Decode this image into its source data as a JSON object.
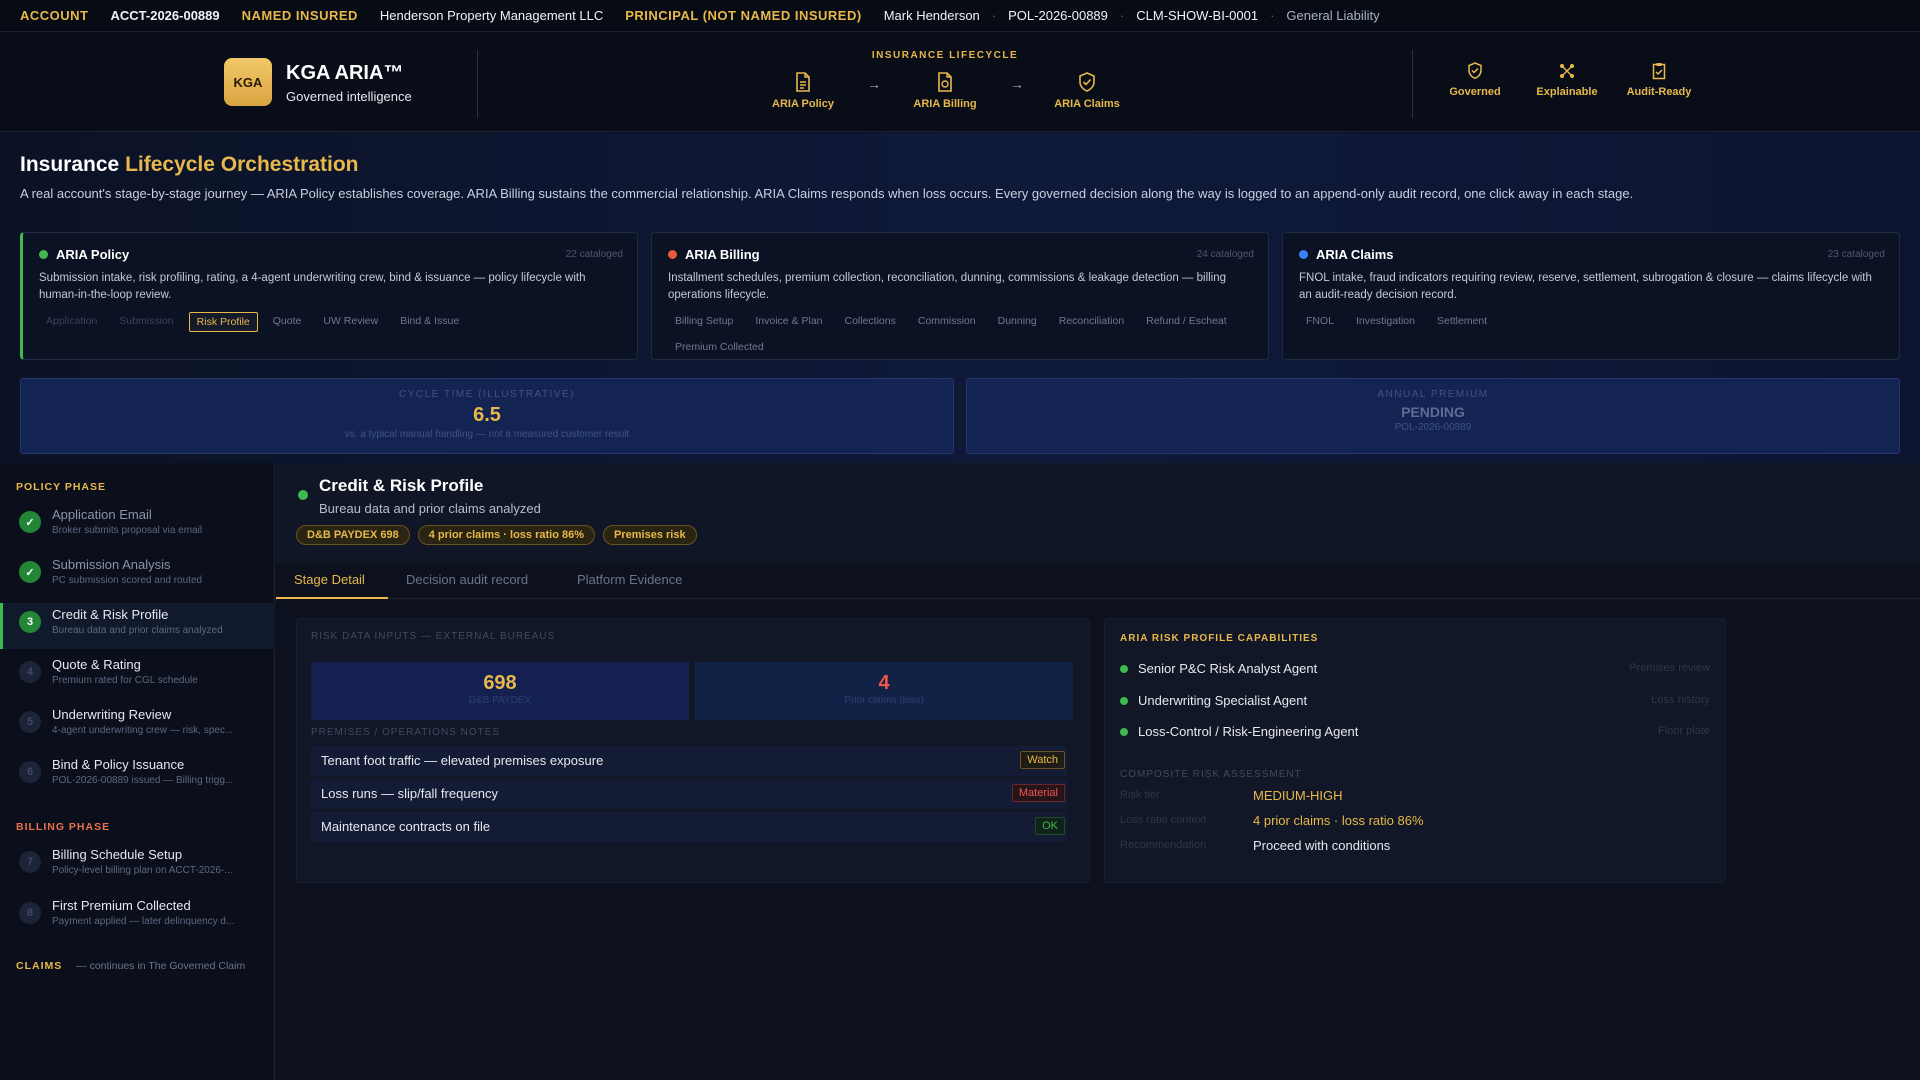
{
  "topbar": {
    "account_label": "ACCOUNT",
    "account_value": "ACCT-2026-00889",
    "named_insured_label": "NAMED INSURED",
    "named_insured_value": "Henderson Property Management LLC",
    "principal_label": "PRINCIPAL (NOT NAMED INSURED)",
    "principal_value": "Mark Henderson",
    "policy_id": "POL-2026-00889",
    "claim_id": "CLM-SHOW-BI-0001",
    "line_of_business": "General Liability",
    "separator": "·"
  },
  "header": {
    "logo_text": "KGA",
    "brand_name": "KGA ARIA™",
    "brand_tagline": "Governed intelligence",
    "lifecycle_title": "INSURANCE LIFECYCLE",
    "lifecycle_steps": [
      {
        "label": "ARIA Policy",
        "icon": "document-icon"
      },
      {
        "label": "ARIA Billing",
        "icon": "invoice-icon"
      },
      {
        "label": "ARIA Claims",
        "icon": "shield-check-icon"
      }
    ],
    "arrow": "→",
    "badges": [
      {
        "label": "Governed",
        "icon": "shield-icon"
      },
      {
        "label": "Explainable",
        "icon": "nodes-icon"
      },
      {
        "label": "Audit-Ready",
        "icon": "clipboard-check-icon"
      }
    ]
  },
  "hero": {
    "title_plain": "Insurance",
    "title_accent": "Lifecycle Orchestration",
    "description": "A real account's stage-by-stage journey — ARIA Policy establishes coverage. ARIA Billing sustains the commercial relationship. ARIA Claims responds when loss occurs. Every governed decision along the way is logged to an append-only audit record, one click away in each stage.",
    "products": [
      {
        "name": "ARIA Policy",
        "count": "22 cataloged",
        "dot_color": "#3fb950",
        "description": "Submission intake, risk profiling, rating, a 4-agent underwriting crew, bind & issuance — policy lifecycle with human-in-the-loop review.",
        "chips": [
          "Application",
          "Submission",
          "Risk Profile",
          "Quote",
          "UW Review",
          "Bind & Issue"
        ]
      },
      {
        "name": "ARIA Billing",
        "count": "24 cataloged",
        "dot_color": "#e8593a",
        "description": "Installment schedules, premium collection, reconciliation, dunning, commissions & leakage detection — billing operations lifecycle.",
        "chips": [
          "Billing Setup",
          "Invoice & Plan",
          "Collections",
          "Commission",
          "Dunning",
          "Reconciliation",
          "Refund / Escheat",
          "Premium Collected"
        ]
      },
      {
        "name": "ARIA Claims",
        "count": "23 cataloged",
        "dot_color": "#3b82f6",
        "description": "FNOL intake, fraud indicators requiring review, reserve, settlement, subrogation & closure — claims lifecycle with an audit-ready decision record.",
        "chips": [
          "FNOL",
          "Investigation",
          "Settlement"
        ]
      }
    ],
    "metrics": [
      {
        "label": "CYCLE TIME (ILLUSTRATIVE)",
        "value": "6.5",
        "sub": "vs. a typical manual handling — not a measured customer result"
      },
      {
        "label": "ANNUAL PREMIUM",
        "value": "PENDING",
        "sub": "POL-2026-00889"
      }
    ]
  },
  "sidebar": {
    "policy_phase": "POLICY PHASE",
    "billing_phase": "BILLING PHASE",
    "claims_phase": "CLAIMS",
    "claims_note": "— continues in The Governed Claim",
    "check": "✓",
    "policy_steps": [
      {
        "num": "1",
        "title": "Application Email",
        "sub": "Broker submits proposal via email"
      },
      {
        "num": "2",
        "title": "Submission Analysis",
        "sub": "PC submission scored and routed"
      },
      {
        "num": "3",
        "title": "Credit & Risk Profile",
        "sub": "Bureau data and prior claims analyzed"
      },
      {
        "num": "4",
        "title": "Quote & Rating",
        "sub": "Premium rated for CGL schedule"
      },
      {
        "num": "5",
        "title": "Underwriting Review",
        "sub": "4-agent underwriting crew — risk, spec..."
      },
      {
        "num": "6",
        "title": "Bind & Policy Issuance",
        "sub": "POL-2026-00889 issued — Billing trigg..."
      }
    ],
    "billing_steps": [
      {
        "num": "7",
        "title": "Billing Schedule Setup",
        "sub": "Policy-level billing plan on ACCT-2026-..."
      },
      {
        "num": "8",
        "title": "First Premium Collected",
        "sub": "Payment applied — later delinquency d..."
      }
    ]
  },
  "stage": {
    "title": "Credit & Risk Profile",
    "subtitle": "Bureau data and prior claims analyzed",
    "tags": [
      "D&B PAYDEX 698",
      "4 prior claims · loss ratio 86%",
      "Premises risk"
    ],
    "tabs": [
      "Stage Detail",
      "Decision audit record",
      "Platform Evidence"
    ]
  },
  "risk_inputs": {
    "label": "RISK DATA INPUTS — EXTERNAL BUREAUS",
    "scores": [
      {
        "value": "698",
        "label": "D&B PAYDEX",
        "color": "#e8b84a"
      },
      {
        "value": "4",
        "label": "Prior claims (loss)",
        "color": "#f0564c"
      }
    ],
    "notes_label": "PREMISES / OPERATIONS NOTES",
    "notes": [
      {
        "text": "Tenant foot traffic — elevated premises exposure",
        "badge": "Watch",
        "kind": "watch"
      },
      {
        "text": "Loss runs — slip/fall frequency",
        "badge": "Material",
        "kind": "material"
      },
      {
        "text": "Maintenance contracts on file",
        "badge": "OK",
        "kind": "ok"
      }
    ]
  },
  "capabilities": {
    "label": "ARIA RISK PROFILE CAPABILITIES",
    "agents": [
      {
        "name": "Senior P&C Risk Analyst Agent",
        "role": "Premises review"
      },
      {
        "name": "Underwriting Specialist Agent",
        "role": "Loss history"
      },
      {
        "name": "Loss-Control / Risk-Engineering Agent",
        "role": "Floor plate"
      }
    ],
    "assessment_label": "COMPOSITE RISK ASSESSMENT",
    "assessment": [
      {
        "key": "Risk tier",
        "value": "MEDIUM-HIGH",
        "color": "#e8b84a"
      },
      {
        "key": "Loss ratio context",
        "value": "4 prior claims · loss ratio 86%",
        "color": "#e8b84a"
      },
      {
        "key": "Recommendation",
        "value": "Proceed with conditions",
        "color": "#e6e9f0"
      }
    ]
  }
}
